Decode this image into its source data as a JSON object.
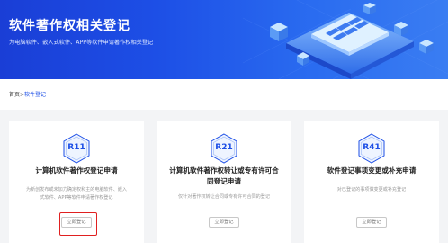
{
  "banner": {
    "title": "软件著作权相关登记",
    "subtitle": "为电脑软件、嵌入式软件、APP等软件申请著作权相关登记"
  },
  "breadcrumb": {
    "home": "首页",
    "separator": ">",
    "current": "软件登记"
  },
  "cards": [
    {
      "code": "R11",
      "title": "计算机软件著作权登记申请",
      "desc_lines": [
        "为新创发布或未加力确定权和主的电脑软件、嵌入",
        "式软件、APP等软件申请著作权登记"
      ],
      "button": "立即登记"
    },
    {
      "code": "R21",
      "title_lines": [
        "计算机软件著作权转让或专有许可合",
        "同登记申请"
      ],
      "desc_lines": [
        "仅针对著作权转让合同或专有许可合同的登记"
      ],
      "button": "立即登记"
    },
    {
      "code": "R41",
      "title": "软件登记事项变更或补充申请",
      "desc_lines": [
        "对已登记的事项做变更或补充登记"
      ],
      "button": "立即登记"
    }
  ],
  "colors": {
    "brand_blue": "#1d4fe6",
    "highlight_red": "#e02020"
  }
}
